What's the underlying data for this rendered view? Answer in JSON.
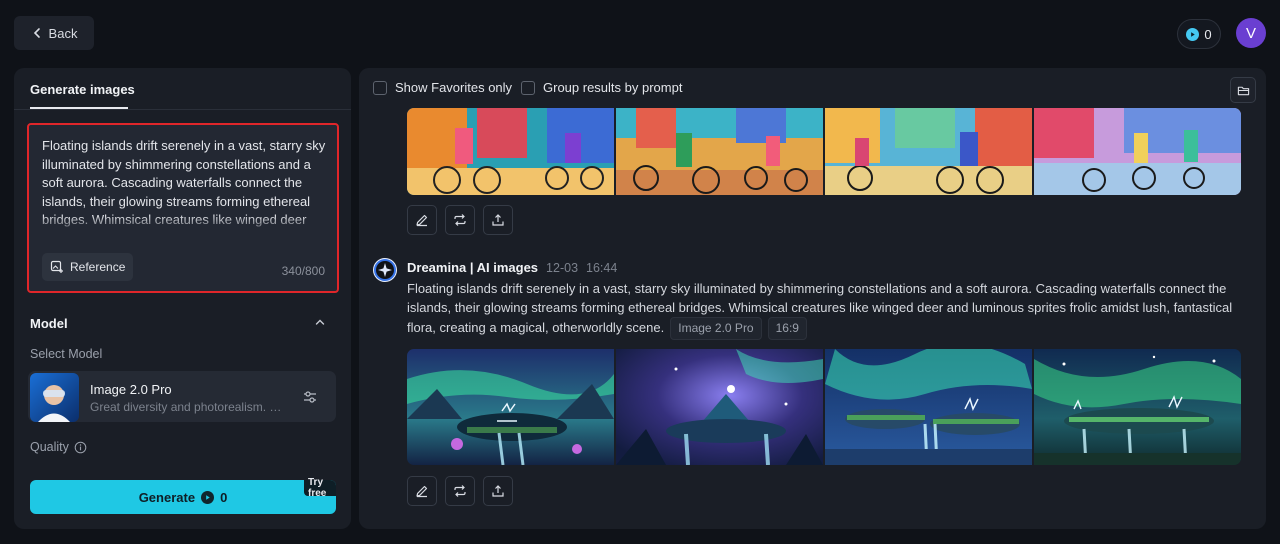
{
  "header": {
    "back_label": "Back",
    "credits": "0",
    "avatar_initial": "V"
  },
  "left_panel": {
    "tab_label": "Generate images",
    "prompt_text": "Floating islands drift serenely in a vast, starry sky illuminated by shimmering constellations and a soft aurora. Cascading waterfalls connect the islands, their glowing streams forming ethereal bridges. Whimsical creatures like winged deer and luminous sprites frolic amidst lush, fantastical flora, creating a magical, otherworldly scene.",
    "reference_label": "Reference",
    "char_count": "340/800",
    "model_section_label": "Model",
    "select_model_label": "Select Model",
    "model_name": "Image 2.0 Pro",
    "model_description": "Great diversity and photorealism. Of...",
    "quality_label": "Quality",
    "generate_label": "Generate",
    "generate_cost": "0",
    "try_free_label": "Try free"
  },
  "right_panel": {
    "show_favorites_label": "Show Favorites only",
    "group_results_label": "Group results by prompt",
    "entry": {
      "name": "Dreamina | AI images",
      "date": "12-03",
      "time": "16:44",
      "prompt": "Floating islands drift serenely in a vast, starry sky illuminated by shimmering constellations and a soft aurora. Cascading waterfalls connect the islands, their glowing streams forming ethereal bridges. Whimsical creatures like winged deer and luminous sprites frolic amidst lush, fantastical flora, creating a magical, otherworldly scene.",
      "model_tag": "Image 2.0 Pro",
      "ratio_tag": "16:9"
    }
  },
  "colors": {
    "accent": "#1fc8e4",
    "highlight_border": "#e0262a",
    "avatar": "#6a3fd1"
  }
}
